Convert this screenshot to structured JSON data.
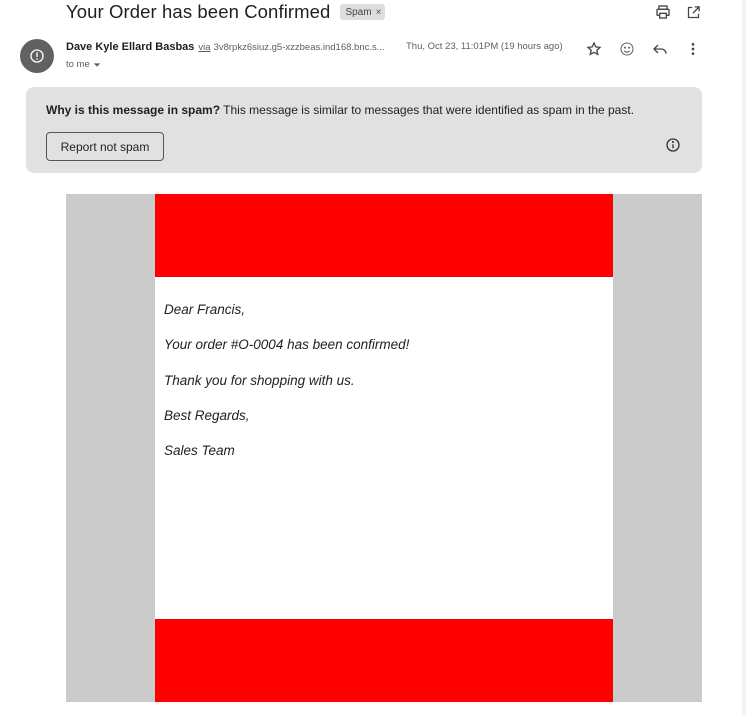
{
  "header": {
    "subject": "Your Order has been Confirmed",
    "label_chip": "Spam",
    "label_chip_remove": "×",
    "actions": [
      "print-icon",
      "open-in-new-window-icon"
    ]
  },
  "message": {
    "sender_name": "Dave Kyle Ellard Basbas",
    "via_label": "via",
    "via_domain": "3v8rpkz6siuz.g5-xzzbeas.ind168.bnc.s...",
    "date": "Thu, Oct 23, 11:01PM (19 hours ago)",
    "recipient": "to me",
    "actions": [
      "star-icon",
      "emoji-reaction-icon",
      "reply-icon",
      "more-vert-icon"
    ]
  },
  "spam_warning": {
    "question": "Why is this message in spam?",
    "explanation": " This message is similar to messages that were identified as spam in the past.",
    "button_label": "Report not spam"
  },
  "email_body": {
    "lines": [
      "Dear Francis,",
      "Your order #O-0004 has been confirmed!",
      "Thank you for shopping with us.",
      "Best Regards,",
      "Sales Team"
    ]
  },
  "colors": {
    "banner_red": "#ff0000",
    "frame_gray": "#cbcbcb",
    "spam_box_bg": "#e1e1e1",
    "avatar_bg": "#616161"
  }
}
